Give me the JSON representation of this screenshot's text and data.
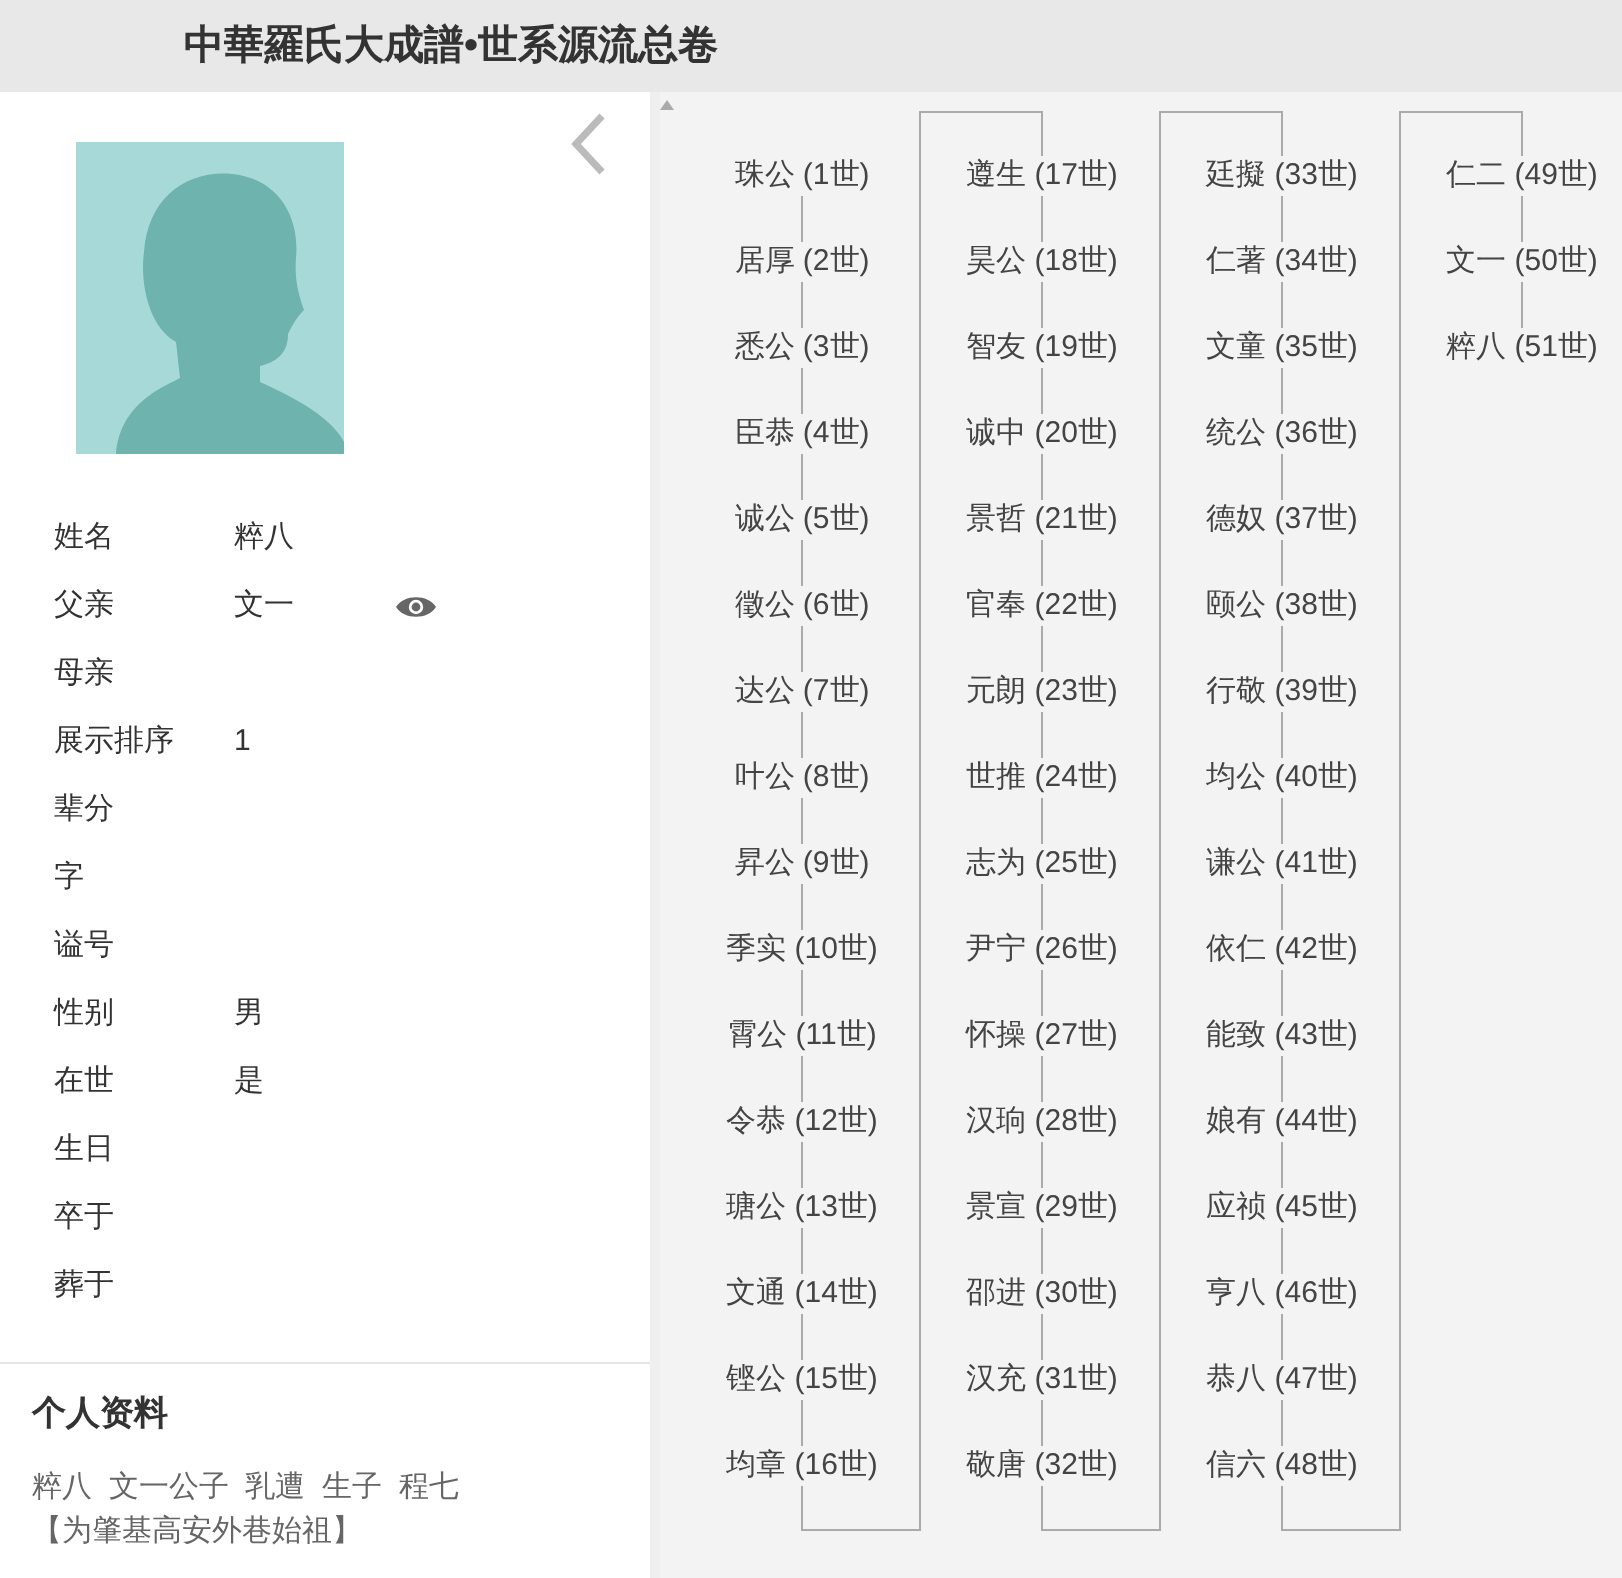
{
  "header": {
    "title": "中華羅氏大成譜•世系源流总卷"
  },
  "profile": {
    "fields": [
      {
        "label": "姓名",
        "value": "粹八"
      },
      {
        "label": "父亲",
        "value": "文一",
        "has_view": true
      },
      {
        "label": "母亲"
      },
      {
        "label": "展示排序",
        "value": "1"
      },
      {
        "label": "辈分"
      },
      {
        "label": "字"
      },
      {
        "label": "谥号"
      },
      {
        "label": "性别",
        "value": "男"
      },
      {
        "label": "在世",
        "value": "是"
      },
      {
        "label": "生日"
      },
      {
        "label": "卒于"
      },
      {
        "label": "葬于"
      }
    ],
    "bio": {
      "heading": "个人资料",
      "lines": [
        "粹八  文一公子  乳遭  生子  程七",
        "【为肇基高安外巷始祖】"
      ]
    }
  },
  "lineage": [
    "珠公 (1世)",
    "居厚 (2世)",
    "悉公 (3世)",
    "臣恭 (4世)",
    "诚公 (5世)",
    "徵公 (6世)",
    "达公 (7世)",
    "叶公 (8世)",
    "昇公 (9世)",
    "季实 (10世)",
    "霄公 (11世)",
    "令恭 (12世)",
    "瑭公 (13世)",
    "文通 (14世)",
    "铿公 (15世)",
    "均章 (16世)",
    "遵生 (17世)",
    "昊公 (18世)",
    "智友 (19世)",
    "诚中 (20世)",
    "景哲 (21世)",
    "官奉 (22世)",
    "元朗 (23世)",
    "世推 (24世)",
    "志为 (25世)",
    "尹宁 (26世)",
    "怀操 (27世)",
    "汉珦 (28世)",
    "景宣 (29世)",
    "邵进 (30世)",
    "汉充 (31世)",
    "敬唐 (32世)",
    "廷擬 (33世)",
    "仁著 (34世)",
    "文童 (35世)",
    "统公 (36世)",
    "德奴 (37世)",
    "颐公 (38世)",
    "行敬 (39世)",
    "均公 (40世)",
    "谦公 (41世)",
    "依仁 (42世)",
    "能致 (43世)",
    "娘有 (44世)",
    "应祯 (45世)",
    "亨八 (46世)",
    "恭八 (47世)",
    "信六 (48世)",
    "仁二 (49世)",
    "文一 (50世)",
    "粹八 (51世)"
  ]
}
